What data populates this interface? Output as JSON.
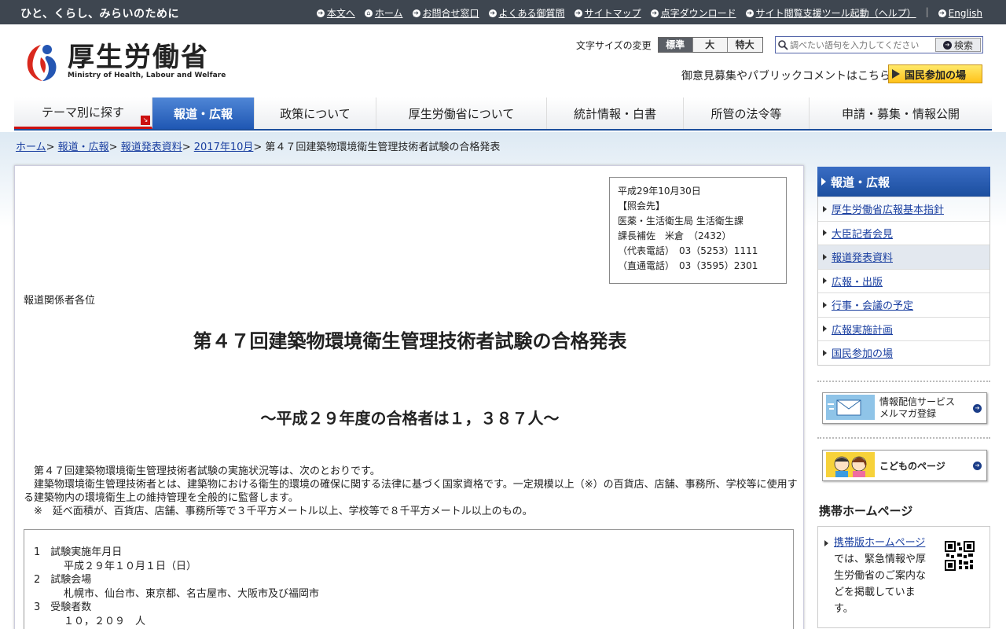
{
  "topbar": {
    "tagline": "ひと、くらし、みらいのために",
    "links": [
      "本文へ",
      "ホーム",
      "お問合せ窓口",
      "よくある御質問",
      "サイトマップ",
      "点字ダウンロード",
      "サイト閲覧支援ツール起動（ヘルプ）"
    ],
    "english": "English"
  },
  "header": {
    "logo_jp": "厚生労働省",
    "logo_en": "Ministry of Health, Labour and Welfare",
    "fontsize_label": "文字サイズの変更",
    "fontsize_options": [
      "標準",
      "大",
      "特大"
    ],
    "search_placeholder": "調べたい語句を入力してください",
    "search_button": "検索",
    "opinion_link": "御意見募集やパブリックコメントはこちら",
    "kokumin_button": "国民参加の場"
  },
  "gnav": [
    "テーマ別に探す",
    "報道・広報",
    "政策について",
    "厚生労働省について",
    "統計情報・白書",
    "所管の法令等",
    "申請・募集・情報公開"
  ],
  "breadcrumb": {
    "items": [
      "ホーム",
      "報道・広報",
      "報道発表資料",
      "2017年10月"
    ],
    "current": "第４７回建築物環境衛生管理技術者試験の合格発表"
  },
  "contact": {
    "text": "平成29年10月30日\n【照会先】\n医薬・生活衛生局 生活衛生課\n課長補佐　米倉　（2432）\n（代表電話）　03（5253）1111\n（直通電話）　03（3595）2301"
  },
  "content": {
    "addressee": "報道関係者各位",
    "title": "第４７回建築物環境衛生管理技術者試験の合格発表",
    "subtitle": "～平成２９年度の合格者は１，３８７人～",
    "para1": "第４７回建築物環境衛生管理技術者試験の実施状況等は、次のとおりです。",
    "para2": "建築物環境衛生管理技術者とは、建築物における衛生的環境の確保に関する法律に基づく国家資格です。一定規模以上（※）の百貨店、店舗、事務所、学校等に使用する建築物内の環境衛生上の維持管理を全般的に監督します。",
    "para3": "※　延べ面積が、百貨店、店舗、事務所等で３千平方メートル以上、学校等で８千平方メートル以上のもの。",
    "items": [
      {
        "head": "1　試験実施年月日",
        "body": "平成２９年１０月１日（日）"
      },
      {
        "head": "2　試験会場",
        "body": "札幌市、仙台市、東京都、名古屋市、大阪市及び福岡市"
      },
      {
        "head": "3　受験者数",
        "body": "１０，２０９　人"
      }
    ]
  },
  "sidebar": {
    "heading": "報道・広報",
    "items": [
      "厚生労働省広報基本指針",
      "大臣記者会見",
      "報道発表資料",
      "広報・出版",
      "行事・会議の予定",
      "広報実施計画",
      "国民参加の場"
    ],
    "banner_mail_line1": "情報配信サービス",
    "banner_mail_line2": "メルマガ登録",
    "banner_kids": "こどものページ",
    "mobile_heading": "携帯ホームページ",
    "mobile_link": "携帯版ホームページ",
    "mobile_text": "では、緊急情報や厚生労働省のご案内などを掲載しています。"
  }
}
